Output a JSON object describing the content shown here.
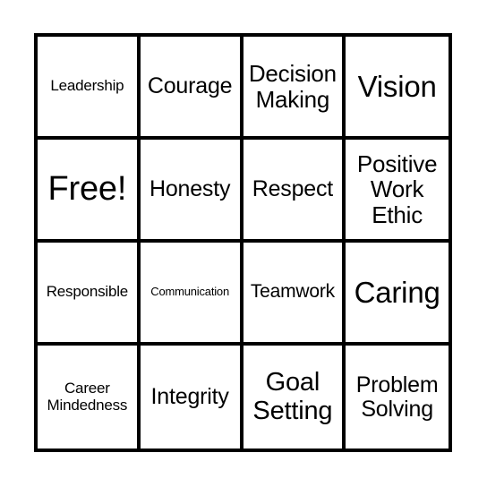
{
  "card": {
    "type": "bingo-card",
    "columns": 4,
    "rows": 4,
    "border_color": "#000000",
    "background_color": "#ffffff",
    "text_color": "#000000",
    "cells": [
      {
        "label": "Leadership",
        "row": 1,
        "col": 1,
        "free_space": false
      },
      {
        "label": "Courage",
        "row": 1,
        "col": 2,
        "free_space": false
      },
      {
        "label": "Decision\nMaking",
        "row": 1,
        "col": 3,
        "free_space": false
      },
      {
        "label": "Vision",
        "row": 1,
        "col": 4,
        "free_space": false
      },
      {
        "label": "Free!",
        "row": 2,
        "col": 1,
        "free_space": true
      },
      {
        "label": "Honesty",
        "row": 2,
        "col": 2,
        "free_space": false
      },
      {
        "label": "Respect",
        "row": 2,
        "col": 3,
        "free_space": false
      },
      {
        "label": "Positive\nWork\nEthic",
        "row": 2,
        "col": 4,
        "free_space": false
      },
      {
        "label": "Responsible",
        "row": 3,
        "col": 1,
        "free_space": false
      },
      {
        "label": "Communication",
        "row": 3,
        "col": 2,
        "free_space": false
      },
      {
        "label": "Teamwork",
        "row": 3,
        "col": 3,
        "free_space": false
      },
      {
        "label": "Caring",
        "row": 3,
        "col": 4,
        "free_space": false
      },
      {
        "label": "Career\nMindedness",
        "row": 4,
        "col": 1,
        "free_space": false
      },
      {
        "label": "Integrity",
        "row": 4,
        "col": 2,
        "free_space": false
      },
      {
        "label": "Goal\nSetting",
        "row": 4,
        "col": 3,
        "free_space": false
      },
      {
        "label": "Problem\nSolving",
        "row": 4,
        "col": 4,
        "free_space": false
      }
    ]
  }
}
